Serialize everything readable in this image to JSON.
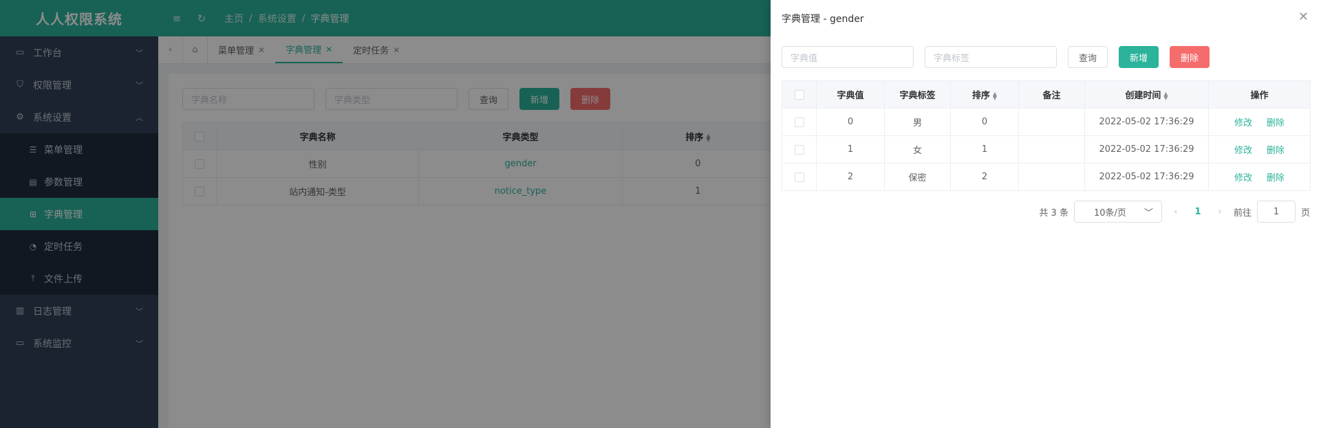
{
  "app": {
    "title": "人人权限系统"
  },
  "sidebar": {
    "items": [
      {
        "label": "工作台",
        "icon": "monitor-icon"
      },
      {
        "label": "权限管理",
        "icon": "shield-icon"
      },
      {
        "label": "系统设置",
        "icon": "gear-icon"
      }
    ],
    "sub_items": [
      {
        "label": "菜单管理",
        "icon": "list-icon"
      },
      {
        "label": "参数管理",
        "icon": "doc-icon"
      },
      {
        "label": "字典管理",
        "icon": "tree-icon"
      },
      {
        "label": "定时任务",
        "icon": "clock-icon"
      },
      {
        "label": "文件上传",
        "icon": "upload-icon"
      }
    ],
    "bottom_items": [
      {
        "label": "日志管理",
        "icon": "log-icon"
      },
      {
        "label": "系统监控",
        "icon": "monitor-icon"
      }
    ]
  },
  "breadcrumb": {
    "home": "主页",
    "sep": "/",
    "level1": "系统设置",
    "level2": "字典管理"
  },
  "tabs": [
    {
      "label": "菜单管理"
    },
    {
      "label": "字典管理"
    },
    {
      "label": "定时任务"
    }
  ],
  "main": {
    "search": {
      "name_placeholder": "字典名称",
      "type_placeholder": "字典类型"
    },
    "buttons": {
      "query": "查询",
      "add": "新增",
      "delete": "删除"
    },
    "table": {
      "headers": [
        "字典名称",
        "字典类型",
        "排序"
      ],
      "rows": [
        {
          "name": "性别",
          "type": "gender",
          "sort": "0"
        },
        {
          "name": "站内通知-类型",
          "type": "notice_type",
          "sort": "1"
        }
      ]
    }
  },
  "drawer": {
    "title": "字典管理 - gender",
    "search": {
      "value_placeholder": "字典值",
      "label_placeholder": "字典标签"
    },
    "buttons": {
      "query": "查询",
      "add": "新增",
      "delete": "删除"
    },
    "table": {
      "headers": [
        "字典值",
        "字典标签",
        "排序",
        "备注",
        "创建时间",
        "操作"
      ],
      "rows": [
        {
          "value": "0",
          "label": "男",
          "sort": "0",
          "remark": "",
          "created": "2022-05-02 17:36:29",
          "edit": "修改",
          "del": "删除"
        },
        {
          "value": "1",
          "label": "女",
          "sort": "1",
          "remark": "",
          "created": "2022-05-02 17:36:29",
          "edit": "修改",
          "del": "删除"
        },
        {
          "value": "2",
          "label": "保密",
          "sort": "2",
          "remark": "",
          "created": "2022-05-02 17:36:29",
          "edit": "修改",
          "del": "删除"
        }
      ]
    },
    "pager": {
      "total": "共 3 条",
      "page_size": "10条/页",
      "current": "1",
      "goto": "前往",
      "goto_value": "1",
      "page_unit": "页"
    }
  },
  "colors": {
    "accent": "#2bb39b",
    "danger": "#f56c6c",
    "sidebar": "#304156"
  }
}
